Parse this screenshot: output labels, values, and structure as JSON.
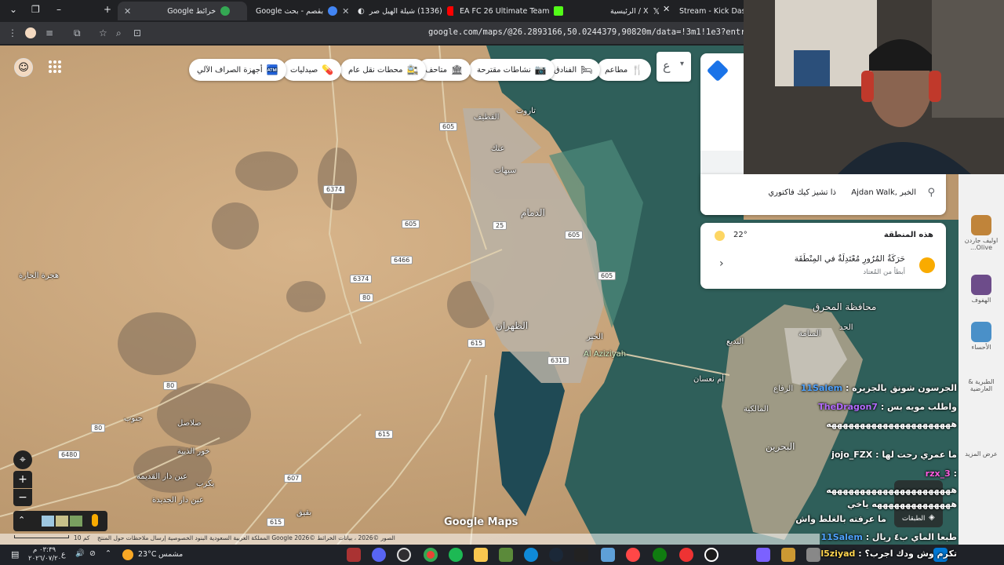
{
  "browser": {
    "tabs": [
      {
        "title": "خرائط Google",
        "icon_color": "#34a853",
        "active": true
      },
      {
        "title": "بقصم - بحث Google",
        "icon_color": "#4285f4",
        "active": false
      },
      {
        "title": "(1336) شيلة الهيل صر",
        "icon_color": "#ff0000",
        "active": false
      },
      {
        "title": "EA FC 26 Ultimate Team",
        "icon_color": "#53fc18",
        "active": false
      },
      {
        "title": "X / الرئيسية",
        "icon_color": "#ffffff",
        "active": false
      },
      {
        "title": "Stream - Kick Dashboard",
        "icon_color": "#53fc18",
        "active": false
      }
    ],
    "new_tab": "+",
    "url": "google.com/maps/@26.2893166,50.0244379,90820m/data=!3m1!1e3?entry=ttu&g_ep=EgoyMDI"
  },
  "map": {
    "chips": [
      {
        "label": "مطاعم",
        "icon": "🍴"
      },
      {
        "label": "الفنادق",
        "icon": "🛏"
      },
      {
        "label": "نشاطات مقترحة",
        "icon": "📷"
      },
      {
        "label": "متاحف",
        "icon": "🏛"
      },
      {
        "label": "محطات نقل عام",
        "icon": "🚉"
      },
      {
        "label": "صيدليات",
        "icon": "💊"
      },
      {
        "label": "أجهزة الصراف الآلي",
        "icon": "🏧"
      }
    ],
    "places": {
      "qatif": "القطيف",
      "dammam": "الدمام",
      "khobar": "الخبر",
      "dhahran": "الظهران",
      "aziziyah": "Al Aziziyah",
      "bahrain": "البحرين",
      "muharraq": "محافظة المحرق",
      "manama": "المنامة",
      "hijrat": "هجرة الحارة",
      "tarout": "تاروت",
      "saihat": "سيهات",
      "anak": "عنك",
      "salasil": "صلاصل",
      "jarudiya": "جنوب",
      "budaiya": "البديع",
      "riffa": "الرفاع",
      "malikiyah": "المالكية",
      "awali": "الحد",
      "umm_nassan": "أم نعسان",
      "jassra": "الجسرة",
      "ain_dar_old": "عين دار القديمة",
      "ain_dar_new": "عين دار الجديدة",
      "khur_dhabiya": "خور الذبية",
      "buqayq": "بقيق",
      "yakrib": "يكرب",
      "kenar": "كوبري الملك فهد"
    },
    "road_shields": [
      "605",
      "6374",
      "605",
      "6466",
      "6374",
      "80",
      "605",
      "615",
      "80",
      "80",
      "6480",
      "615",
      "607",
      "615",
      "605",
      "6318",
      "615",
      "615",
      "25"
    ],
    "watermark": "Google Maps",
    "scale": "10 كم",
    "attribution": "الصور ©2026 ، بيانات الخرائط ©2026 Google   المملكة العربية السعودية   البنود   الخصوصية   إرسال ملاحظات حول المنتج"
  },
  "side_panel": {
    "place_text": "Ajdan Walk, الخبر",
    "place_sub": "ذا تشيز كيك فاكتوري",
    "area_title": "هذه المنطقة",
    "temperature": "22°",
    "traffic_title": "حَرَكَةُ المُرُورِ مُعْتَدِلَةٌ في المِنْطَقَة",
    "traffic_sub": "أبطأ من المُعتاد",
    "chevron": "›",
    "collapse_btn": "ع",
    "layers_label": "الطبقات"
  },
  "kick_sidebar": [
    {
      "label": "اوليف جاردن Olive...",
      "color": "#c0843a"
    },
    {
      "label": "الهفوف",
      "color": "#6d4c8a"
    },
    {
      "label": "الأحساء",
      "color": "#4a90c8"
    },
    {
      "label": "الطبرية & العارضية",
      "color": "#8a8a8a"
    },
    {
      "label": "عرض المزيد",
      "color": "#cccccc"
    }
  ],
  "chat": [
    {
      "user": "11Salem",
      "text": "الجرسون شونق بالجزيره :",
      "color": "#4fa3ff"
    },
    {
      "user": "TheDragon7",
      "text": "واطلب مويه بس :",
      "color": "#b46bff"
    },
    {
      "user": "",
      "text": "ههههههههههههههههههههههه",
      "color": "#ffffff"
    },
    {
      "user": "jojo_FZX",
      "text": "ما عمري رحت لها :",
      "color": "#ffffff"
    },
    {
      "user": "rzx_3",
      "text": ":",
      "color": "#ff5ce1"
    },
    {
      "user": "",
      "text": "ههههههههههههههههههههههه",
      "color": "#ffffff"
    },
    {
      "user": "",
      "text": "ههههههههههههههه ياخي",
      "color": "#ffffff"
    },
    {
      "user": "",
      "text": "ما عرفته بالغلط واش",
      "color": "#ffffff"
    },
    {
      "user": "11Salem",
      "text": "طبعا الماي ب٤ ريال :",
      "color": "#4fa3ff"
    },
    {
      "user": "l5ziyad",
      "text": "تكرم وش ودك اجرب؟ :",
      "color": "#ffd54f"
    }
  ],
  "taskbar": {
    "weather_temp": "23°C",
    "weather_text": "مشمس",
    "time": "٠٣:٣٩ م",
    "date": "٢٠٢٦/٠٧/٢٠",
    "lang": "ع"
  }
}
